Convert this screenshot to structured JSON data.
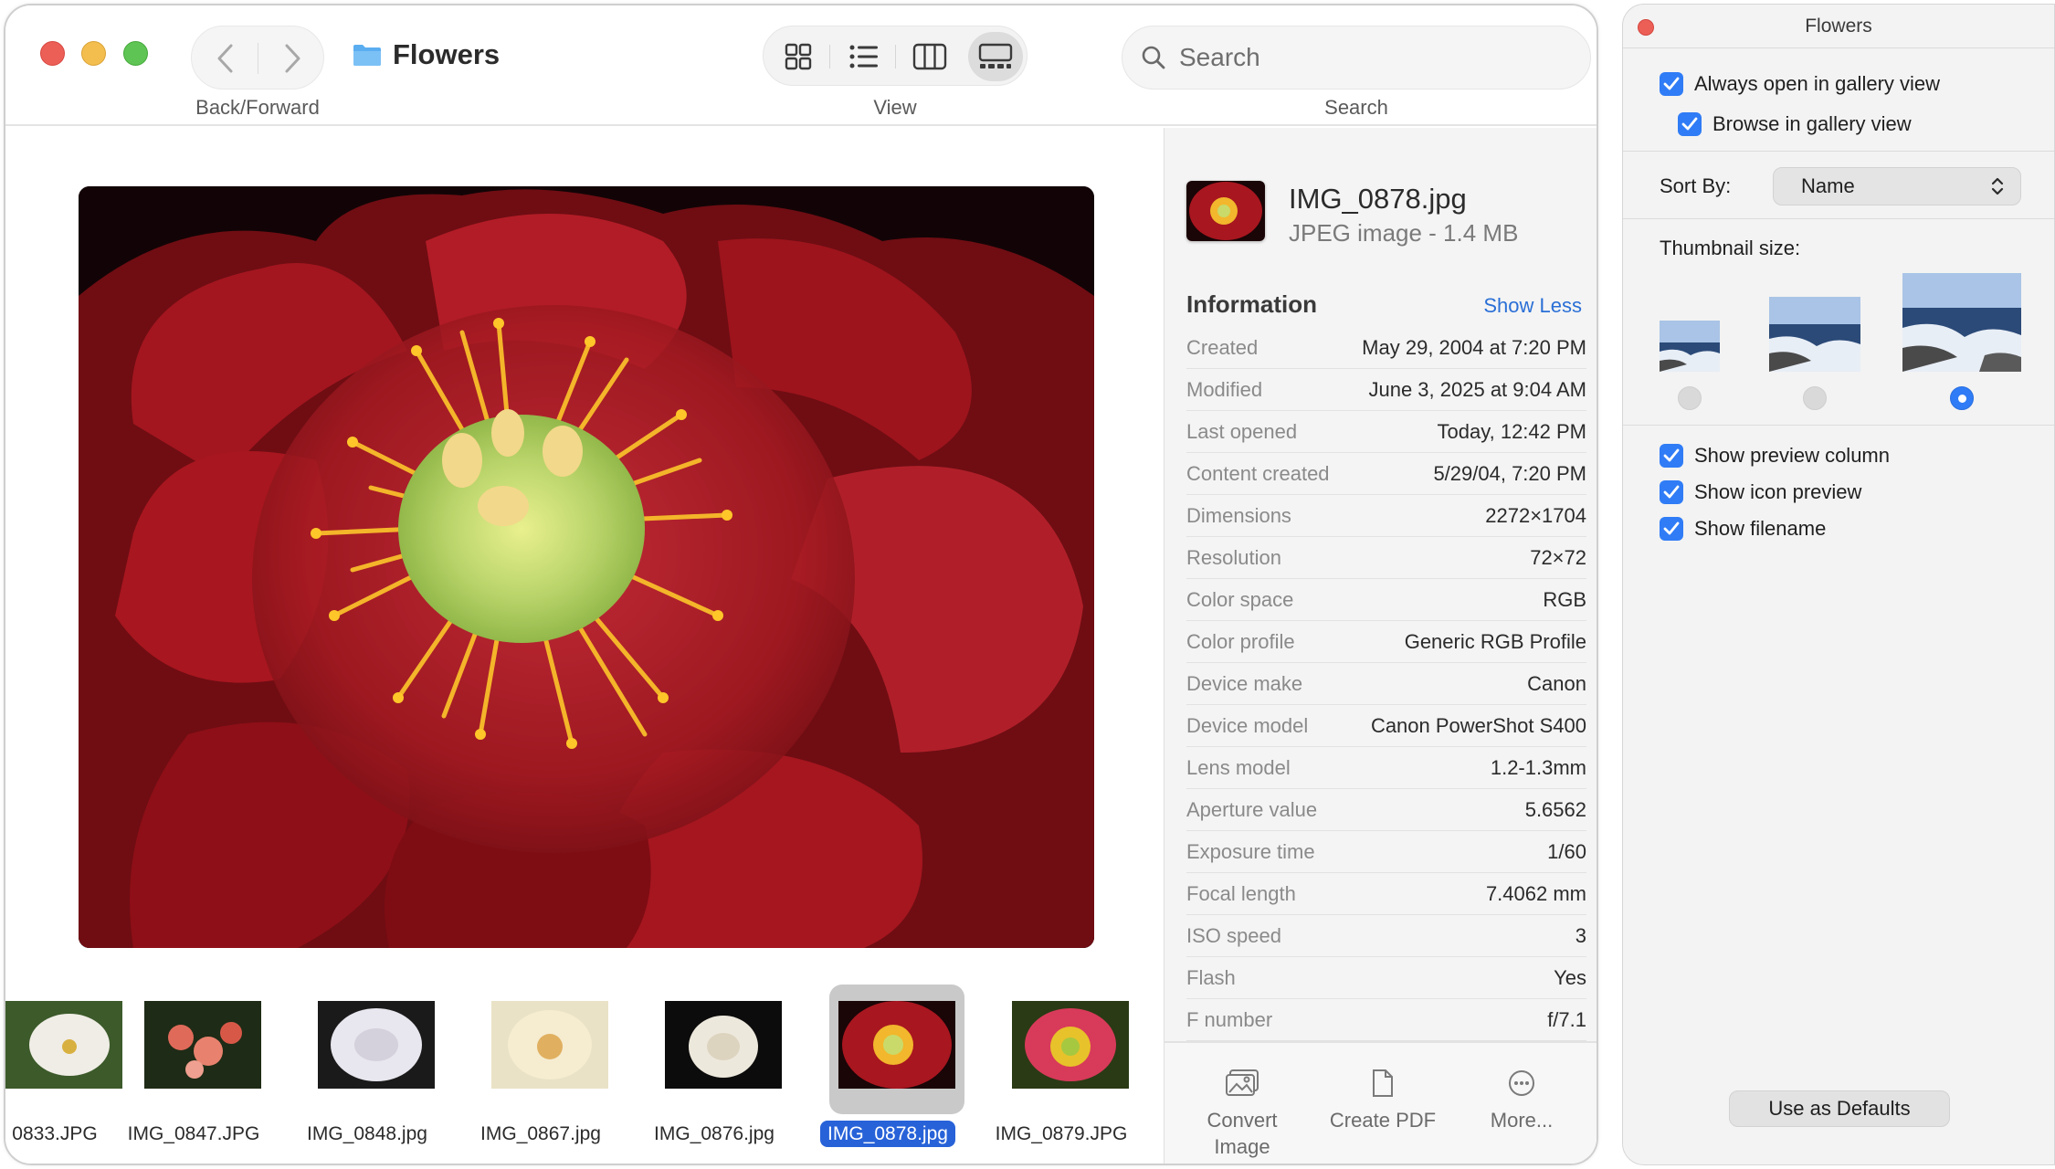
{
  "window": {
    "folder_name": "Flowers",
    "captions": {
      "back_forward": "Back/Forward",
      "view": "View",
      "search": "Search"
    },
    "search": {
      "placeholder": "Search",
      "value": ""
    }
  },
  "view_modes": [
    {
      "name": "icon-view",
      "active": false
    },
    {
      "name": "list-view",
      "active": false
    },
    {
      "name": "column-view",
      "active": false
    },
    {
      "name": "gallery-view",
      "active": true
    }
  ],
  "thumbnails": [
    {
      "label": "0833.JPG",
      "selected": false
    },
    {
      "label": "IMG_0847.JPG",
      "selected": false
    },
    {
      "label": "IMG_0848.jpg",
      "selected": false
    },
    {
      "label": "IMG_0867.jpg",
      "selected": false
    },
    {
      "label": "IMG_0876.jpg",
      "selected": false
    },
    {
      "label": "IMG_0878.jpg",
      "selected": true
    },
    {
      "label": "IMG_0879.JPG",
      "selected": false
    }
  ],
  "info": {
    "filename": "IMG_0878.jpg",
    "filetype": "JPEG image - 1.4 MB",
    "section_title": "Information",
    "show_less": "Show Less",
    "rows": [
      {
        "key": "Created",
        "value": "May 29, 2004 at 7:20 PM"
      },
      {
        "key": "Modified",
        "value": "June 3, 2025 at 9:04 AM"
      },
      {
        "key": "Last opened",
        "value": "Today, 12:42 PM"
      },
      {
        "key": "Content created",
        "value": "5/29/04, 7:20 PM"
      },
      {
        "key": "Dimensions",
        "value": "2272×1704"
      },
      {
        "key": "Resolution",
        "value": "72×72"
      },
      {
        "key": "Color space",
        "value": "RGB"
      },
      {
        "key": "Color profile",
        "value": "Generic RGB Profile"
      },
      {
        "key": "Device make",
        "value": "Canon"
      },
      {
        "key": "Device model",
        "value": "Canon PowerShot S400"
      },
      {
        "key": "Lens model",
        "value": "1.2-1.3mm"
      },
      {
        "key": "Aperture value",
        "value": "5.6562"
      },
      {
        "key": "Exposure time",
        "value": "1/60"
      },
      {
        "key": "Focal length",
        "value": "7.4062 mm"
      },
      {
        "key": "ISO speed",
        "value": "3"
      },
      {
        "key": "Flash",
        "value": "Yes"
      },
      {
        "key": "F number",
        "value": "f/7.1"
      }
    ],
    "actions": [
      {
        "label": "Convert\nImage",
        "icon": "convert-image-icon"
      },
      {
        "label": "Create PDF",
        "icon": "create-pdf-icon"
      },
      {
        "label": "More...",
        "icon": "more-icon"
      }
    ]
  },
  "view_options": {
    "title": "Flowers",
    "always_open_gallery": {
      "label": "Always open in gallery view",
      "checked": true
    },
    "browse_gallery": {
      "label": "Browse in gallery view",
      "checked": true
    },
    "sort_by_label": "Sort By:",
    "sort_by_value": "Name",
    "thumbnail_size_label": "Thumbnail size:",
    "thumbnail_size_selected": "large",
    "show_preview_column": {
      "label": "Show preview column",
      "checked": true
    },
    "show_icon_preview": {
      "label": "Show icon preview",
      "checked": true
    },
    "show_filename": {
      "label": "Show filename",
      "checked": true
    },
    "defaults_button": "Use as Defaults"
  },
  "colors": {
    "accent": "#2f7cf6",
    "selection": "#2762d8",
    "link": "#2a6fd6",
    "close": "#ec5f57",
    "minimize": "#f4be4f",
    "zoom": "#5ec454"
  }
}
